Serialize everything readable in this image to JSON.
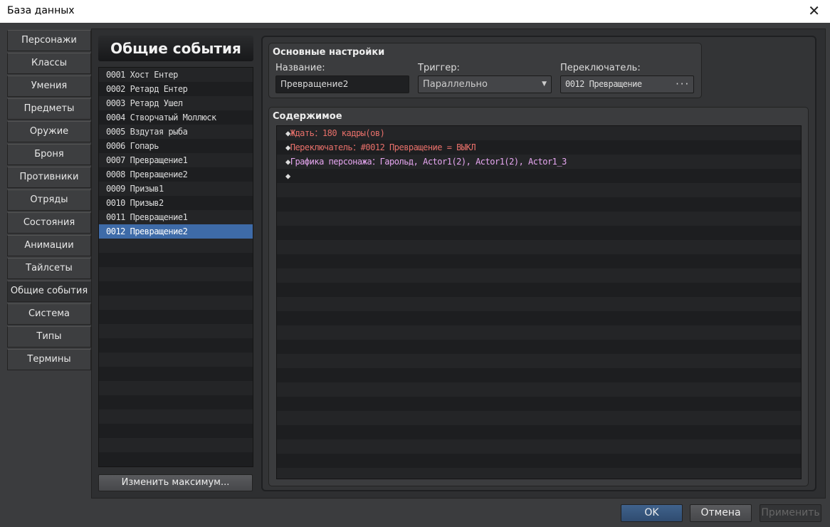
{
  "window": {
    "title": "База данных"
  },
  "sidebar": {
    "tabs": [
      "Персонажи",
      "Классы",
      "Умения",
      "Предметы",
      "Оружие",
      "Броня",
      "Противники",
      "Отряды",
      "Состояния",
      "Анимации",
      "Тайлсеты",
      "Общие события",
      "Система",
      "Типы",
      "Термины"
    ],
    "active": 11
  },
  "list": {
    "header": "Общие события",
    "items": [
      "0001 Хост Ентер",
      "0002 Ретард Ентер",
      "0003 Ретард Ушел",
      "0004 Створчатый Моллюск",
      "0005 Вздутая рыба",
      "0006 Гопарь",
      "0007 Превращение1",
      "0008 Превращение2",
      "0009 Призыв1",
      "0010 Призыв2",
      "0011 Превращение1",
      "0012 Превращение2"
    ],
    "selected": 11,
    "change_max_label": "Изменить максимум..."
  },
  "settings": {
    "title": "Основные настройки",
    "name_label": "Название:",
    "name_value": "Превращение2",
    "trigger_label": "Триггер:",
    "trigger_value": "Параллельно",
    "switch_label": "Переключатель:",
    "switch_value": "0012 Превращение",
    "switch_btn": "···"
  },
  "contents": {
    "title": "Содержимое",
    "commands": [
      {
        "diamond": "◆",
        "name": "Ждать",
        "sep": "：",
        "args": "180 кадры(ов)",
        "color": "#e8706a"
      },
      {
        "diamond": "◆",
        "name": "Переключатель",
        "sep": "：",
        "args": "#0012 Превращение = ВЫКЛ",
        "color": "#e8706a"
      },
      {
        "diamond": "◆",
        "name": "Графика персонажа",
        "sep": "：",
        "args": "Гарольд, Actor1(2), Actor1(2), Actor1_3",
        "color": "#e6a6f0"
      },
      {
        "diamond": "◆",
        "name": "",
        "sep": "",
        "args": "",
        "color": "#ddd"
      }
    ]
  },
  "footer": {
    "ok": "OK",
    "cancel": "Отмена",
    "apply": "Применить"
  }
}
